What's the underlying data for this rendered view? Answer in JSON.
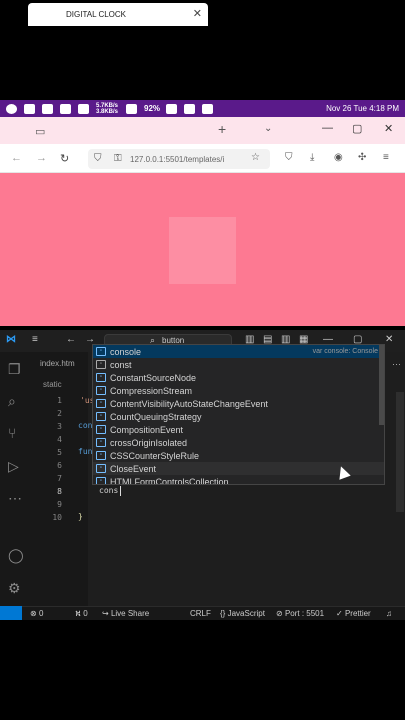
{
  "statusbar": {
    "net_up": "5.7KB/s",
    "net_down": "3.8KB/s",
    "battery": "92%",
    "datetime": "Nov 26 Tue 4:18 PM"
  },
  "browser": {
    "tab_title": "DIGITAL CLOCK",
    "url": "127.0.0.1:5501/templates/i"
  },
  "vscode": {
    "command_center": "button",
    "file_tab": "index.htm",
    "breadcrumb": "static",
    "line_numbers": [
      "1",
      "2",
      "3",
      "4",
      "5",
      "6",
      "7",
      "8",
      "9",
      "10"
    ],
    "code_fragments": {
      "l2": "'us",
      "l4": "con",
      "l6": "fun",
      "l8": "cons",
      "l10": "}"
    },
    "suggestions": [
      {
        "label": "console",
        "detail": "var console: Console"
      },
      {
        "label": "const",
        "detail": ""
      },
      {
        "label": "ConstantSourceNode",
        "detail": ""
      },
      {
        "label": "CompressionStream",
        "detail": ""
      },
      {
        "label": "ContentVisibilityAutoStateChangeEvent",
        "detail": ""
      },
      {
        "label": "CountQueuingStrategy",
        "detail": ""
      },
      {
        "label": "CompositionEvent",
        "detail": ""
      },
      {
        "label": "crossOriginIsolated",
        "detail": ""
      },
      {
        "label": "CSSCounterStyleRule",
        "detail": ""
      },
      {
        "label": "CloseEvent",
        "detail": ""
      },
      {
        "label": "HTMLFormControlsCollection",
        "detail": ""
      }
    ],
    "status": {
      "errors": "0",
      "ports": "0",
      "live_share": "Live Share",
      "eol": "CRLF",
      "language": "JavaScript",
      "port": "Port : 5501",
      "prettier": "Prettier"
    }
  }
}
